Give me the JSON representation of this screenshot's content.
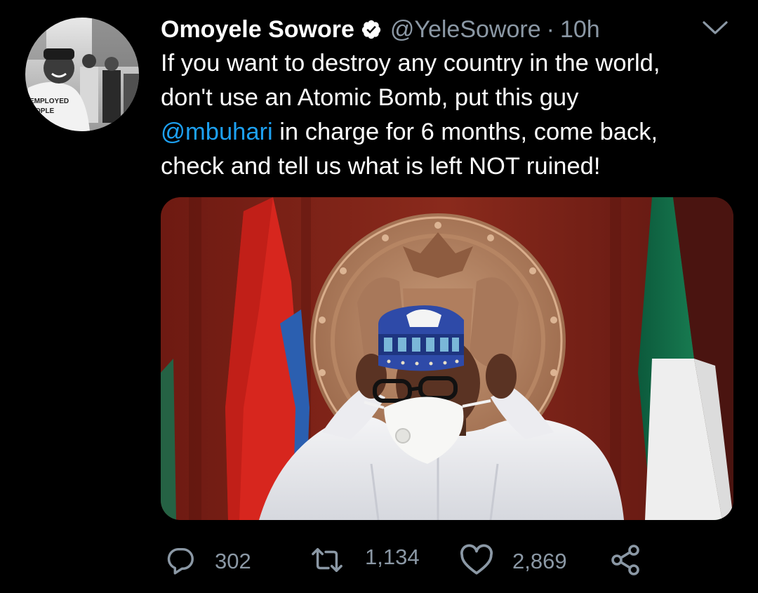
{
  "author": {
    "display_name": "Omoyele Sowore",
    "verified": true,
    "handle": "@YeleSowore",
    "separator": "·",
    "timestamp": "10h",
    "avatar_shirt_text": [
      "EMPLOYED",
      "OPLE"
    ]
  },
  "tweet": {
    "line1": "If you want to destroy any country in the world,",
    "line2": "don't use an Atomic Bomb, put this guy",
    "mention": "@mbuhari",
    "line3_rest": " in charge for 6 months, come back,",
    "line4": "check and tell us what is left NOT ruined!"
  },
  "actions": {
    "replies": "302",
    "retweets": "1,134",
    "likes": "2,869"
  },
  "icons": {
    "verified": "verified-badge-icon",
    "menu": "chevron-down-icon",
    "reply": "reply-icon",
    "retweet": "retweet-icon",
    "like": "heart-icon",
    "share": "share-icon"
  },
  "colors": {
    "background": "#000000",
    "text": "#ffffff",
    "secondary": "#8b98a5",
    "link": "#1da1f2"
  }
}
